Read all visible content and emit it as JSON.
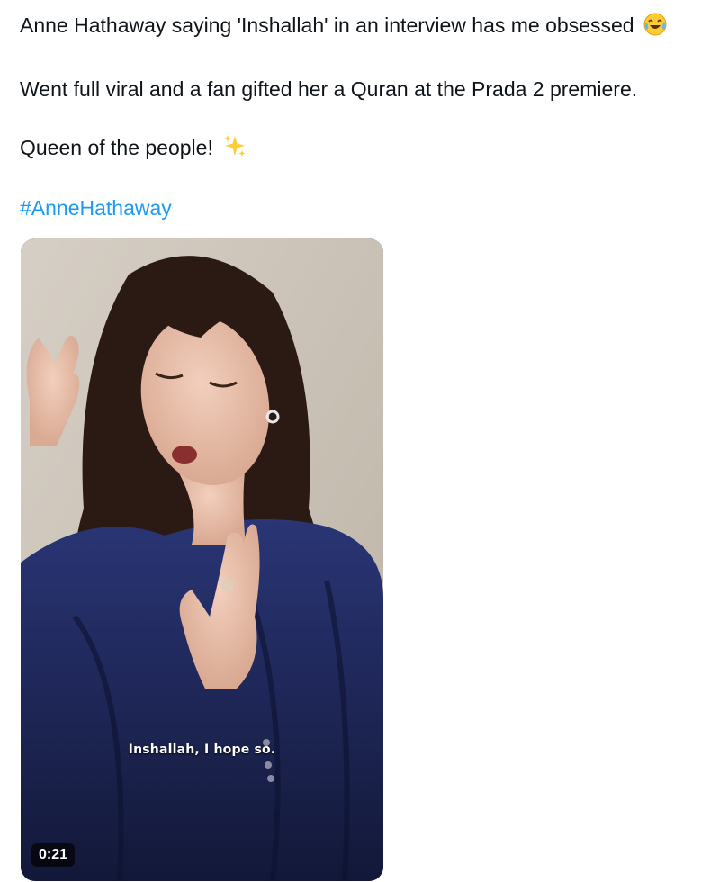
{
  "tweet": {
    "line1": "Anne Hathaway saying 'Inshallah' in an interview has me obsessed",
    "line1_emoji": "face-with-tears-of-joy-icon",
    "line2": "Went full viral and a fan gifted her a Quran at the Prada 2 premiere.",
    "line3": "Queen of the people!",
    "line3_emoji": "sparkles-icon",
    "hashtag": "#AnneHathaway"
  },
  "video": {
    "caption": "Inshallah, I hope so.",
    "duration": "0:21"
  },
  "colors": {
    "text": "#0f1419",
    "link": "#1d9bf0",
    "velvet": "#1b2446"
  }
}
